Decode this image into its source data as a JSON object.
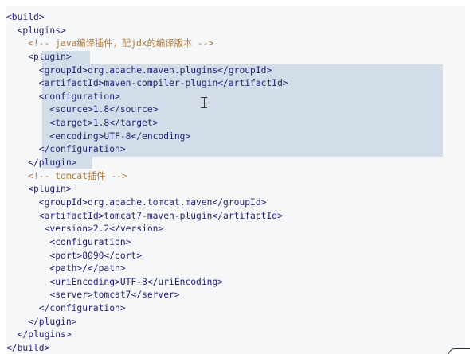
{
  "editor": {
    "lines": [
      {
        "text": "<build>",
        "kind": "tag"
      },
      {
        "text": "  <plugins>",
        "kind": "tag"
      },
      {
        "text": "    <!-- java编译插件，配jdk的编译版本 -->",
        "kind": "comment"
      },
      {
        "text": "    <plugin>",
        "kind": "tag"
      },
      {
        "text": "      <groupId>org.apache.maven.plugins</groupId>",
        "kind": "tag"
      },
      {
        "text": "      <artifactId>maven-compiler-plugin</artifactId>",
        "kind": "tag"
      },
      {
        "text": "      <configuration>",
        "kind": "tag"
      },
      {
        "text": "        <source>1.8</source>",
        "kind": "tag"
      },
      {
        "text": "        <target>1.8</target>",
        "kind": "tag"
      },
      {
        "text": "        <encoding>UTF-8</encoding>",
        "kind": "tag"
      },
      {
        "text": "      </configuration>",
        "kind": "tag"
      },
      {
        "text": "    </plugin>",
        "kind": "tag"
      },
      {
        "text": "    <!-- tomcat插件 -->",
        "kind": "comment"
      },
      {
        "text": "    <plugin>",
        "kind": "tag"
      },
      {
        "text": "      <groupId>org.apache.tomcat.maven</groupId>",
        "kind": "tag"
      },
      {
        "text": "      <artifactId>tomcat7-maven-plugin</artifactId>",
        "kind": "tag"
      },
      {
        "text": "       <version>2.2</version>",
        "kind": "tag"
      },
      {
        "text": "        <configuration>",
        "kind": "tag"
      },
      {
        "text": "        <port>8090</port>",
        "kind": "tag"
      },
      {
        "text": "        <path>/</path>",
        "kind": "tag"
      },
      {
        "text": "        <uriEncoding>UTF-8</uriEncoding>",
        "kind": "tag"
      },
      {
        "text": "        <server>tomcat7</server>",
        "kind": "tag"
      },
      {
        "text": "      </configuration>",
        "kind": "tag"
      },
      {
        "text": "    </plugin>",
        "kind": "tag"
      },
      {
        "text": "  </plugins>",
        "kind": "tag"
      },
      {
        "text": "</build>",
        "kind": "tag"
      }
    ]
  },
  "colors": {
    "panel_background": "#f5f7f9",
    "selection": "#d3dde9",
    "tag_text": "#23237a",
    "comment_text": "#b07a3a"
  },
  "icons": {
    "cursor": "text-cursor-icon"
  }
}
